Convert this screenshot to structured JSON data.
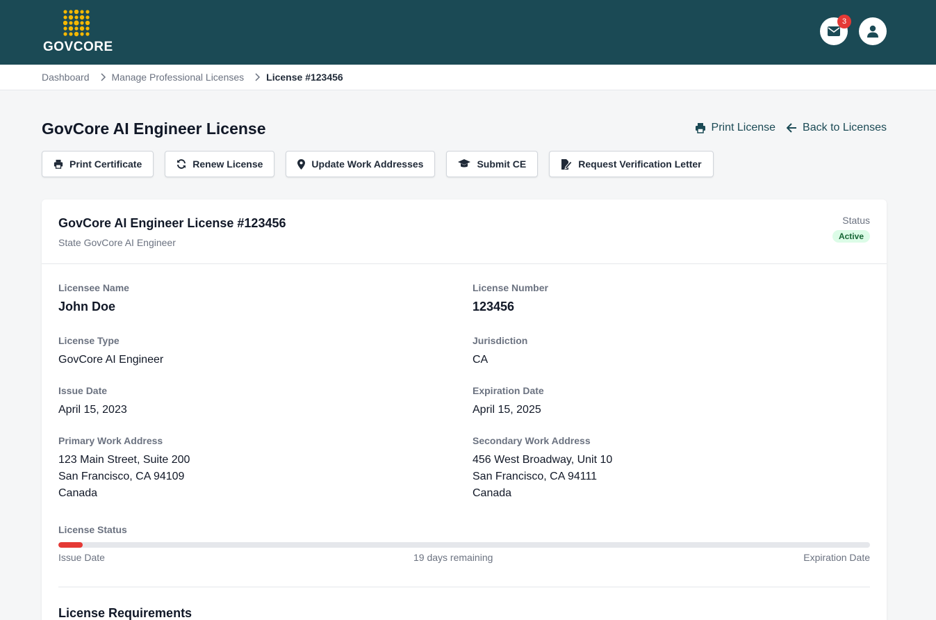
{
  "header": {
    "logo_text": "GOVCORE",
    "brand_color": "#1b4a55",
    "logo_color": "#f5b800",
    "notifications": {
      "icon": "envelope-icon",
      "count": "3"
    },
    "user_icon": "user-icon"
  },
  "breadcrumb": {
    "items": [
      "Dashboard",
      "Manage Professional Licenses"
    ],
    "current": "License #123456"
  },
  "page": {
    "title": "GovCore AI Engineer License",
    "print_license": "Print License",
    "back_to_licenses": "Back to Licenses"
  },
  "actions": {
    "print_certificate": "Print Certificate",
    "renew_license": "Renew License",
    "update_work_addresses": "Update Work Addresses",
    "submit_ce": "Submit CE",
    "request_verification_letter": "Request Verification Letter"
  },
  "card": {
    "title": "GovCore AI Engineer License #123456",
    "subtitle": "State GovCore AI Engineer",
    "status_label": "Status",
    "status_value": "Active",
    "status_color": "#166534"
  },
  "fields": {
    "licensee_name": {
      "label": "Licensee Name",
      "value": "John Doe"
    },
    "license_number": {
      "label": "License Number",
      "value": "123456"
    },
    "license_type": {
      "label": "License Type",
      "value": "GovCore AI Engineer"
    },
    "jurisdiction": {
      "label": "Jurisdiction",
      "value": "CA"
    },
    "issue_date": {
      "label": "Issue Date",
      "value": "April 15, 2023"
    },
    "expiration_date": {
      "label": "Expiration Date",
      "value": "April 15, 2025"
    },
    "primary_address": {
      "label": "Primary Work Address",
      "line1": "123 Main Street, Suite 200",
      "line2": "San Francisco, CA 94109",
      "line3": "Canada"
    },
    "secondary_address": {
      "label": "Secondary Work Address",
      "line1": "456 West Broadway, Unit 10",
      "line2": "San Francisco, CA 94111",
      "line3": "Canada"
    }
  },
  "license_status": {
    "label": "License Status",
    "start_label": "Issue Date",
    "remaining": "19 days remaining",
    "end_label": "Expiration Date",
    "elapsed_fraction": 0.03,
    "bar_color": "#e53935"
  },
  "requirements": {
    "title": "License Requirements"
  }
}
